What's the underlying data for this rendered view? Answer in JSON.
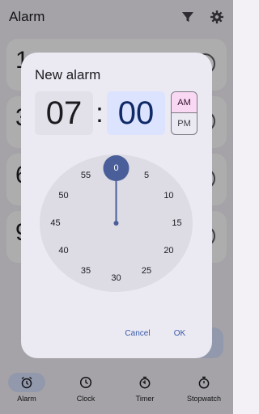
{
  "app": {
    "title": "Alarm",
    "icons": {
      "filter": "filter-icon",
      "settings": "gear-icon"
    }
  },
  "alarms": [
    {
      "time": "1"
    },
    {
      "time": "3"
    },
    {
      "time": "6"
    },
    {
      "time": "9"
    }
  ],
  "nav": {
    "items": [
      {
        "label": "Alarm",
        "icon": "alarm-icon",
        "active": true
      },
      {
        "label": "Clock",
        "icon": "clock-icon",
        "active": false
      },
      {
        "label": "Timer",
        "icon": "timer-icon",
        "active": false
      },
      {
        "label": "Stopwatch",
        "icon": "stopwatch-icon",
        "active": false
      }
    ]
  },
  "dialog": {
    "title": "New alarm",
    "hour": "07",
    "separator": ":",
    "minute": "00",
    "am_label": "AM",
    "pm_label": "PM",
    "selected_period": "AM",
    "clock_numbers": [
      "0",
      "5",
      "10",
      "15",
      "20",
      "25",
      "30",
      "35",
      "40",
      "45",
      "50",
      "55"
    ],
    "selected_minute": "0",
    "cancel_label": "Cancel",
    "ok_label": "OK"
  },
  "colors": {
    "accent": "#4a5f99",
    "selected_minute_box": "#dbe3ff",
    "am_selected": "#f8d8f2",
    "action_text": "#3b5ba9"
  }
}
